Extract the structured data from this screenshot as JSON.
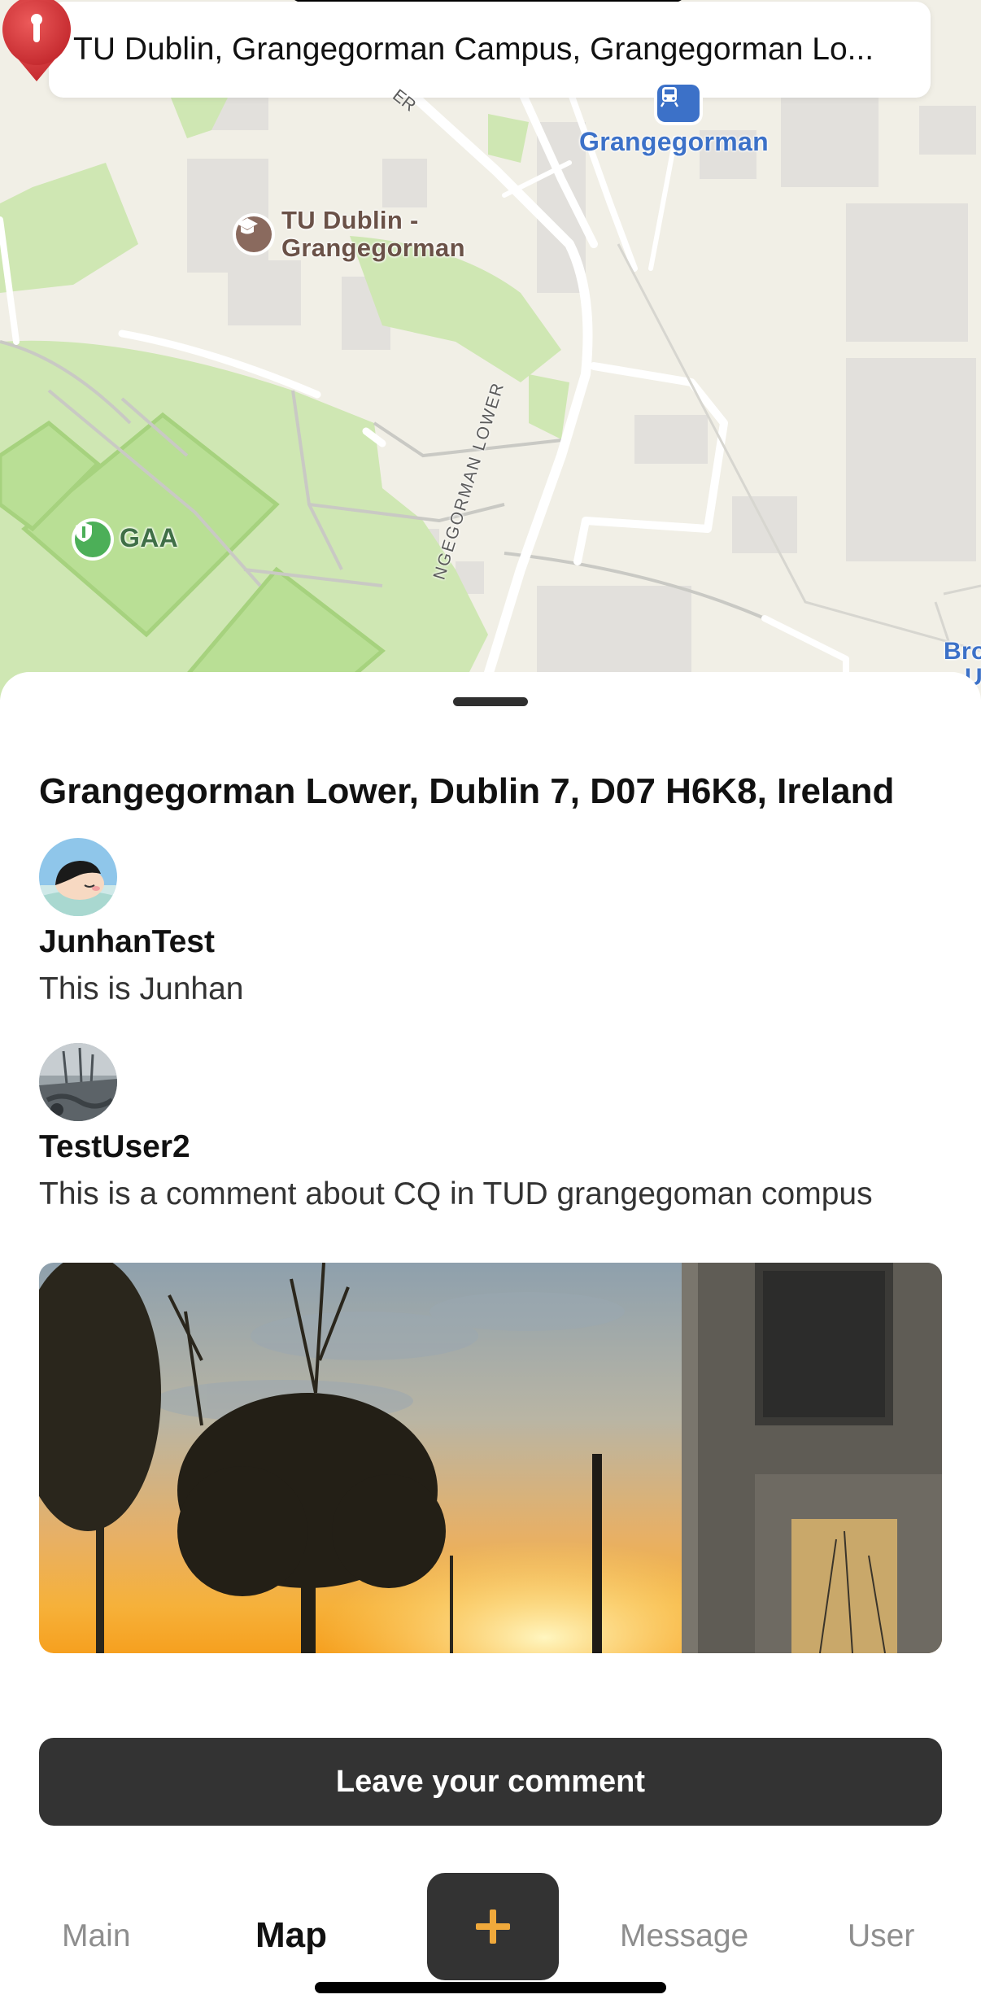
{
  "search": {
    "value": "TU Dublin, Grangegorman Campus, Grangegorman Lo..."
  },
  "map": {
    "poi_tud": "TU Dublin -\nGrangegorman",
    "poi_tud_line1": "TU Dublin -",
    "poi_tud_line2": "Grangegorman",
    "poi_gaa": "GAA",
    "poi_station": "Grangegorman",
    "poi_broadstone": "Bro\nU",
    "street_lower": "NGEGORMAN LOWER",
    "street_top": "ER",
    "icons": [
      "graduation-cap-icon",
      "shield-icon",
      "tram-icon",
      "map-pin-icon"
    ]
  },
  "sheet": {
    "address": "Grangegorman Lower, Dublin 7, D07 H6K8, Ireland",
    "comments": [
      {
        "user": "JunhanTest",
        "text": "This is Junhan"
      },
      {
        "user": "TestUser2",
        "text": "This is a comment about CQ in TUD grangegoman compus"
      }
    ],
    "comment_button": "Leave your comment"
  },
  "tabs": {
    "main": "Main",
    "map": "Map",
    "add": "+",
    "message": "Message",
    "user": "User",
    "active": "map"
  },
  "colors": {
    "accent": "#f0a93b",
    "dark_button": "#333333",
    "park_green": "#c8e6a8",
    "pin_red": "#d8373b",
    "transit_blue": "#3c71c8"
  }
}
